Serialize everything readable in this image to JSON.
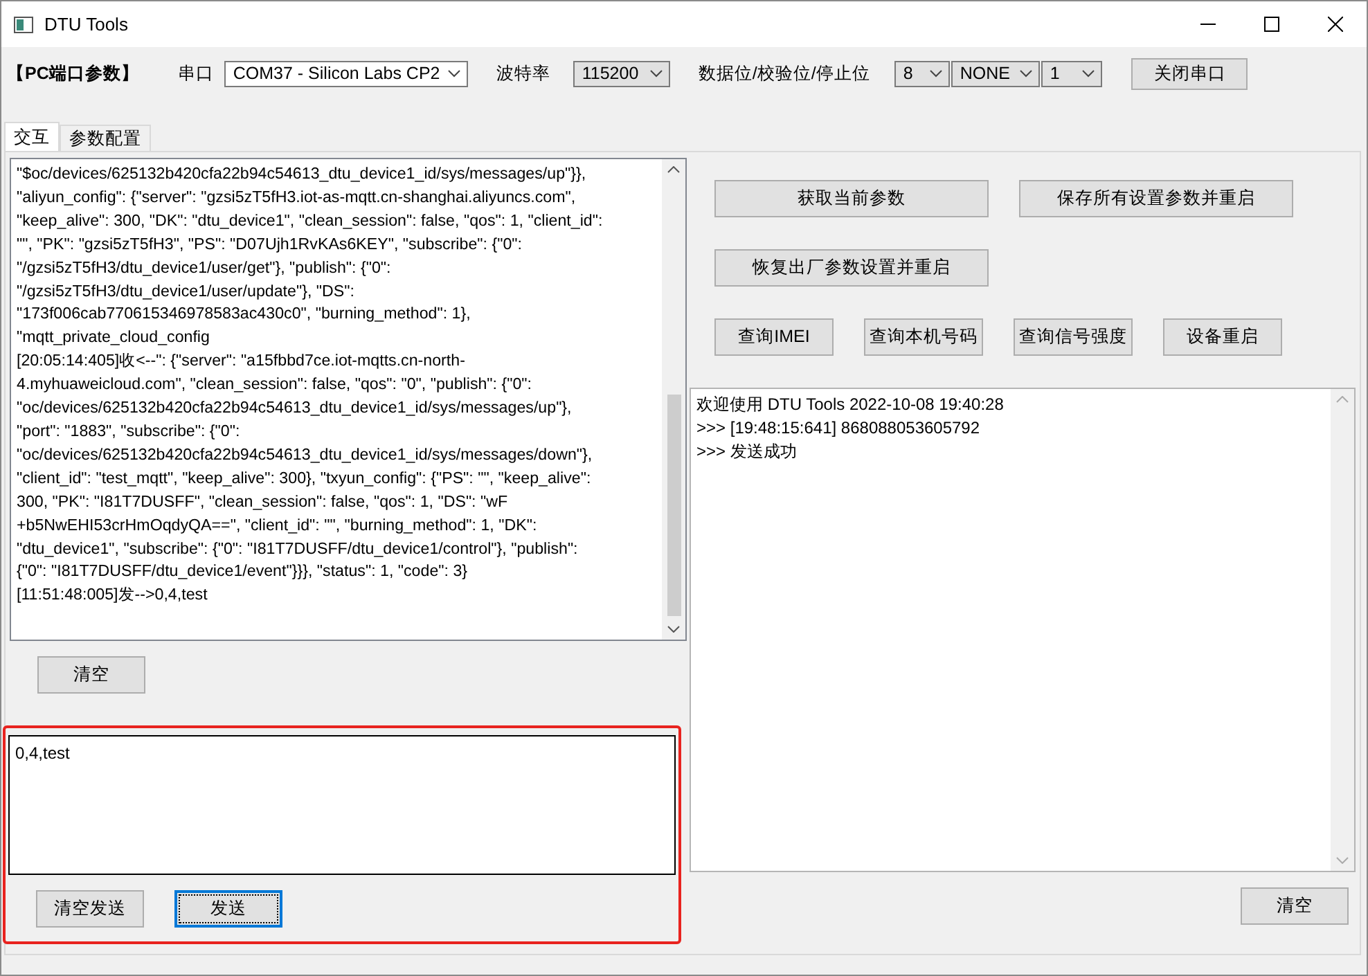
{
  "window": {
    "title": "DTU Tools"
  },
  "port_params": {
    "section_label": "【PC端口参数】",
    "port_label": "串口",
    "port_value": "COM37 - Silicon Labs CP2",
    "baud_label": "波特率",
    "baud_value": "115200",
    "format_label": "数据位/校验位/停止位",
    "data_bits": "8",
    "parity": "NONE",
    "stop_bits": "1",
    "close_button": "关闭串口"
  },
  "tabs": [
    {
      "label": "交互",
      "selected": true
    },
    {
      "label": "参数配置",
      "selected": false
    }
  ],
  "log_lines": [
    "\"$oc/devices/625132b420cfa22b94c54613_dtu_device1_id/sys/messages/up\"}},",
    "\"aliyun_config\": {\"server\": \"gzsi5zT5fH3.iot-as-mqtt.cn-shanghai.aliyuncs.com\",",
    "\"keep_alive\": 300, \"DK\": \"dtu_device1\", \"clean_session\": false, \"qos\": 1, \"client_id\":",
    "\"\", \"PK\": \"gzsi5zT5fH3\", \"PS\": \"D07Ujh1RvKAs6KEY\", \"subscribe\": {\"0\":",
    "\"/gzsi5zT5fH3/dtu_device1/user/get\"}, \"publish\": {\"0\":",
    "\"/gzsi5zT5fH3/dtu_device1/user/update\"}, \"DS\":",
    "\"173f006cab770615346978583ac430c0\", \"burning_method\": 1},",
    "\"mqtt_private_cloud_config",
    "[20:05:14:405]收<--\": {\"server\": \"a15fbbd7ce.iot-mqtts.cn-north-",
    "4.myhuaweicloud.com\", \"clean_session\": false, \"qos\": \"0\", \"publish\": {\"0\":",
    "\"oc/devices/625132b420cfa22b94c54613_dtu_device1_id/sys/messages/up\"},",
    "\"port\": \"1883\", \"subscribe\": {\"0\":",
    "\"oc/devices/625132b420cfa22b94c54613_dtu_device1_id/sys/messages/down\"},",
    "\"client_id\": \"test_mqtt\", \"keep_alive\": 300}, \"txyun_config\": {\"PS\": \"\", \"keep_alive\":",
    "300, \"PK\": \"I81T7DUSFF\", \"clean_session\": false, \"qos\": 1, \"DS\": \"wF",
    "+b5NwEHI53crHmOqdyQA==\", \"client_id\": \"\", \"burning_method\": 1, \"DK\":",
    "\"dtu_device1\", \"subscribe\": {\"0\": \"I81T7DUSFF/dtu_device1/control\"}, \"publish\":",
    "{\"0\": \"I81T7DUSFF/dtu_device1/event\"}}}, \"status\": 1, \"code\": 3}",
    "[11:51:48:005]发-->0,4,test"
  ],
  "log_clear_button": "清空",
  "send_field": {
    "value": "0,4,test"
  },
  "clear_send_button": "清空发送",
  "send_button": {
    "label": "发送",
    "focused": true
  },
  "action_buttons": [
    [
      "获取当前参数",
      "保存所有设置参数并重启"
    ],
    [
      "恢复出厂参数设置并重启"
    ],
    [
      "查询IMEI",
      "查询本机号码",
      "查询信号强度",
      "设备重启"
    ]
  ],
  "output_lines": [
    "欢迎使用 DTU Tools 2022-10-08 19:40:28",
    ">>> [19:48:15:641]   868088053605792",
    ">>> 发送成功"
  ],
  "output_clear_button": "清空"
}
